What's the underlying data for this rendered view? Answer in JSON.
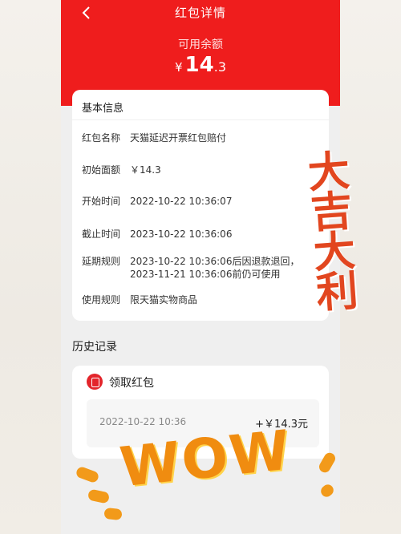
{
  "header": {
    "title": "红包详情",
    "balance_label": "可用余额",
    "currency": "¥",
    "balance_int": "14",
    "balance_dec": ".3"
  },
  "info": {
    "title": "基本信息",
    "rows": [
      {
        "label": "红包名称",
        "value": "天猫延迟开票红包赔付"
      },
      {
        "label": "初始面额",
        "value": "￥14.3"
      },
      {
        "label": "开始时间",
        "value": "2022-10-22 10:36:07"
      },
      {
        "label": "截止时间",
        "value": "2023-10-22 10:36:06"
      },
      {
        "label": "延期规则",
        "value": "2023-10-22 10:36:06后因退款退回，\n2023-11-21 10:36:06前仍可使用"
      },
      {
        "label": "使用规则",
        "value": "限天猫实物商品"
      }
    ]
  },
  "history": {
    "title": "历史记录",
    "receive_label": "领取红包",
    "record_time": "2022-10-22 10:36",
    "record_amount": "+￥14.3元"
  },
  "decor": {
    "stamp_text": [
      "大",
      "吉",
      "大",
      "利"
    ],
    "wow_text": "WOW"
  }
}
